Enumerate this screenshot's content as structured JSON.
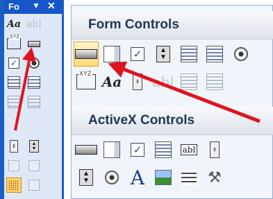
{
  "toolbar": {
    "title": "Fo",
    "dropdown_glyph": "▼",
    "close_glyph": "✕",
    "label_glyph": "Aa",
    "textbox_glyph": "ab|",
    "group_label": "XYZ"
  },
  "panel": {
    "form_controls_title": "Form Controls",
    "activex_controls_title": "ActiveX Controls",
    "label_glyph": "Aa",
    "textbox_glyph": "ab|",
    "group_label": "XYZ",
    "activex_textbox_glyph": "abl",
    "activex_label_glyph": "A",
    "checkbox_glyph": "✓",
    "spin_up": "▲",
    "spin_down": "▼"
  },
  "colors": {
    "toolbar_blue": "#1557c9",
    "selected_fill": "#ffd979",
    "arrow_red": "#e0141e"
  }
}
